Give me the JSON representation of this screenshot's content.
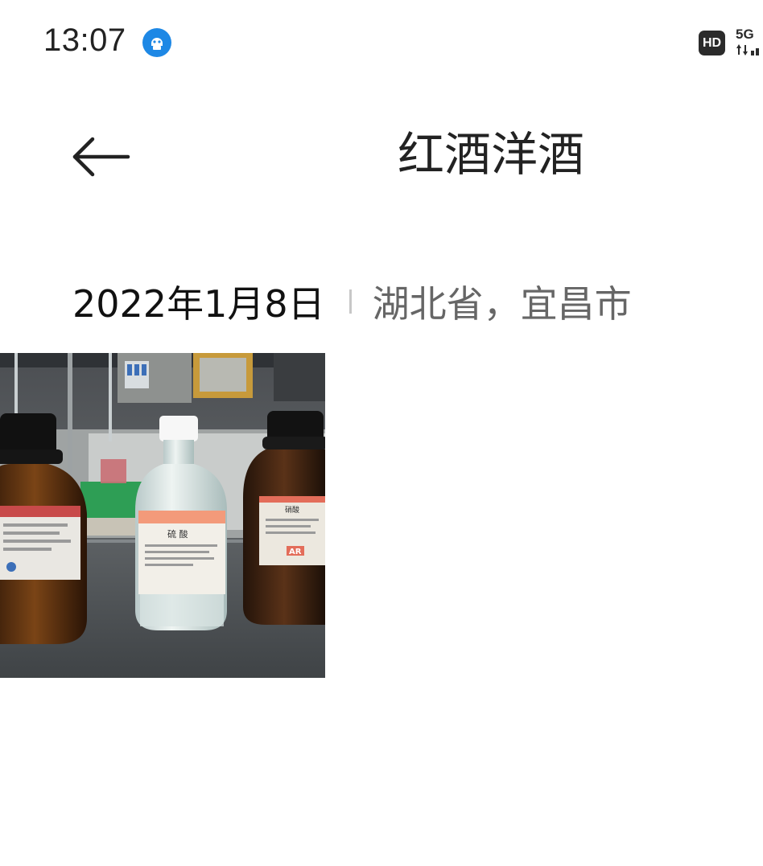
{
  "status_bar": {
    "time": "13:07",
    "hd_label": "HD",
    "network_label": "5G",
    "notification_icon": "smart-assistant-icon",
    "network_icon": "signal-5g-icon"
  },
  "header": {
    "back_icon": "back-arrow-icon",
    "title": "红酒洋酒"
  },
  "meta": {
    "date": "2022年1月8日",
    "location": "湖北省，宜昌市"
  },
  "photos": [
    {
      "label_center_text": "硫 酸",
      "label_right_text": "硝酸",
      "label_right_grade": "AR"
    }
  ],
  "colors": {
    "accent_blue": "#1e88e5",
    "text_primary": "#111111",
    "text_secondary": "#666666",
    "divider": "#c7c7c7"
  }
}
